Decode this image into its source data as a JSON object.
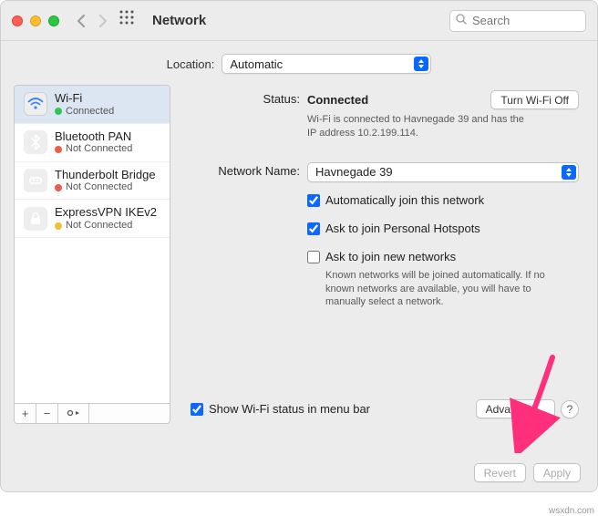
{
  "toolbar": {
    "title": "Network",
    "search_placeholder": "Search"
  },
  "location": {
    "label": "Location:",
    "value": "Automatic"
  },
  "services": [
    {
      "name": "Wi-Fi",
      "state": "Connected",
      "color": "green",
      "icon": "wifi",
      "selected": true
    },
    {
      "name": "Bluetooth PAN",
      "state": "Not Connected",
      "color": "red",
      "icon": "bt",
      "selected": false
    },
    {
      "name": "Thunderbolt Bridge",
      "state": "Not Connected",
      "color": "red",
      "icon": "tb",
      "selected": false
    },
    {
      "name": "ExpressVPN IKEv2",
      "state": "Not Connected",
      "color": "yellow",
      "icon": "vpn",
      "selected": false
    }
  ],
  "detail": {
    "status_label": "Status:",
    "status_value": "Connected",
    "wifi_toggle": "Turn Wi-Fi Off",
    "status_desc": "Wi-Fi is connected to Havnegade 39 and has the IP address 10.2.199.114.",
    "netname_label": "Network Name:",
    "netname_value": "Havnegade 39",
    "check_auto": "Automatically join this network",
    "check_hotspot": "Ask to join Personal Hotspots",
    "check_newnet": "Ask to join new networks",
    "newnet_desc": "Known networks will be joined automatically. If no known networks are available, you will have to manually select a network.",
    "show_status": "Show Wi-Fi status in menu bar",
    "advanced": "Advanced…",
    "help": "?"
  },
  "footer": {
    "revert": "Revert",
    "apply": "Apply"
  },
  "watermark": "wsxdn.com"
}
